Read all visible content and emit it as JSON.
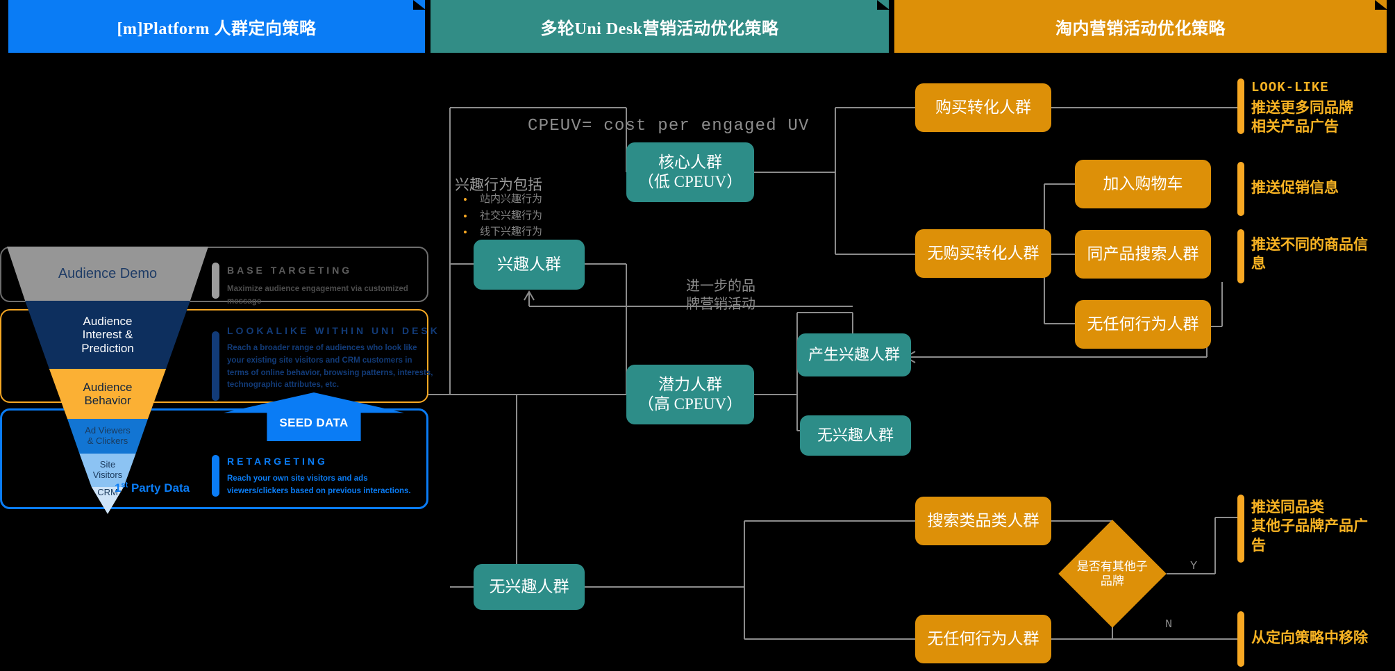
{
  "banners": [
    {
      "id": "platform",
      "label": "[m]Platform 人群定向策略",
      "color": "#0a7cf5"
    },
    {
      "id": "unidesk",
      "label": "多轮Uni Desk营销活动优化策略",
      "color": "#328d86"
    },
    {
      "id": "taonei",
      "label": "淘内营销活动优化策略",
      "color": "#dd9008"
    }
  ],
  "funnel": {
    "segments": [
      {
        "id": "demo",
        "label": "Audience Demo",
        "color": "#969696"
      },
      {
        "id": "interest",
        "label": "Audience\nInterest &\nPrediction",
        "color": "#0d2f5e"
      },
      {
        "id": "behavior",
        "label": "Audience\nBehavior",
        "color": "#fbb034"
      },
      {
        "id": "adviewers",
        "label": "Ad Viewers\n& Clickers",
        "color": "#1275d3"
      },
      {
        "id": "sitevisitors",
        "label": "Site\nVisitors",
        "color": "#8cc3f3"
      },
      {
        "id": "crm",
        "label": "CRM",
        "color": "#cfe4f8"
      }
    ],
    "first_party_label": "1st Party Data",
    "first_party_sup": "st",
    "seed_data_label": "SEED DATA"
  },
  "strategy_blocks": [
    {
      "id": "base-targeting",
      "title": "BASE TARGETING",
      "body": "Maximize audience engagement via customized message",
      "color": "#5c5c5c"
    },
    {
      "id": "lookalike",
      "title": "LOOKALIKE WITHIN UNI DESK",
      "body": "Reach a broader range of audiences who look like your existing site visitors and CRM customers in terms of online behavior, browsing patterns, interests, technographic attributes, etc.",
      "color": "#123b78"
    },
    {
      "id": "retargeting",
      "title": "RETARGETING",
      "body": "Reach your own site visitors and ads viewers/clickers based on previous interactions.",
      "color": "#0a7cf5"
    }
  ],
  "middle": {
    "cpeuv_definition": "CPEUV= cost per engaged UV",
    "interest_behavior_heading": "兴趣行为包括",
    "interest_behavior_items": [
      "站内兴趣行为",
      "社交兴趣行为",
      "线下兴趣行为"
    ],
    "brand_campaign_note": "进一步的品\n牌营销活动",
    "nodes": [
      {
        "id": "core-audience",
        "label": "核心人群\n（低 CPEUV）"
      },
      {
        "id": "interest-audience",
        "label": "兴趣人群"
      },
      {
        "id": "potential-audience",
        "label": "潜力人群\n（高 CPEUV）"
      },
      {
        "id": "generated-interest",
        "label": "产生兴趣人群"
      },
      {
        "id": "no-interest-upper",
        "label": "无兴趣人群"
      },
      {
        "id": "no-interest-lower",
        "label": "无兴趣人群"
      }
    ]
  },
  "right": {
    "nodes": [
      {
        "id": "purchase-converted",
        "label": "购买转化人群"
      },
      {
        "id": "no-purchase-converted",
        "label": "无购买转化人群"
      },
      {
        "id": "add-to-cart",
        "label": "加入购物车"
      },
      {
        "id": "same-product-search",
        "label": "同产品搜索人群"
      },
      {
        "id": "no-behavior-upper",
        "label": "无任何行为人群"
      },
      {
        "id": "category-search",
        "label": "搜索类品类人群"
      },
      {
        "id": "no-behavior-lower",
        "label": "无任何行为人群"
      }
    ],
    "decision": {
      "id": "other-subbrand",
      "label": "是否有其他子\n品牌"
    },
    "branch_labels": {
      "yes": "Y",
      "no": "N"
    },
    "annotations": [
      {
        "id": "look-like",
        "title": "LOOK-LIKE",
        "body": "推送更多同品牌\n相关产品广告"
      },
      {
        "id": "promo-info",
        "title": "",
        "body": "推送促销信息"
      },
      {
        "id": "different-products",
        "title": "",
        "body": "推送不同的商品信\n息"
      },
      {
        "id": "same-category",
        "title": "",
        "body": "推送同品类\n其他子品牌产品广\n告"
      },
      {
        "id": "remove-targeting",
        "title": "",
        "body": "从定向策略中移除"
      }
    ]
  },
  "colors": {
    "blue": "#0a7cf5",
    "teal": "#2d8d88",
    "orange": "#dd9008",
    "amber": "#f8b323",
    "wire": "#8c8c8c"
  }
}
